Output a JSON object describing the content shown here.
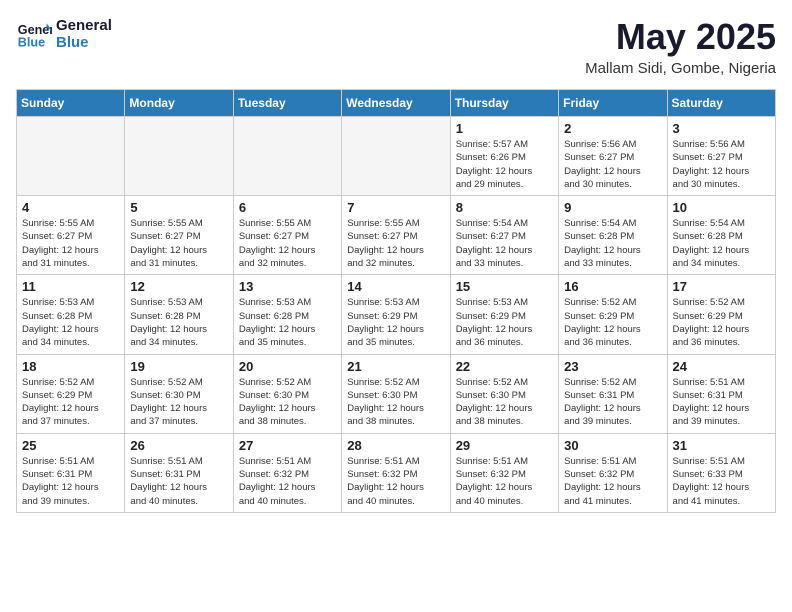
{
  "header": {
    "logo_line1": "General",
    "logo_line2": "Blue",
    "month_year": "May 2025",
    "location": "Mallam Sidi, Gombe, Nigeria"
  },
  "days_of_week": [
    "Sunday",
    "Monday",
    "Tuesday",
    "Wednesday",
    "Thursday",
    "Friday",
    "Saturday"
  ],
  "weeks": [
    [
      {
        "day": "",
        "info": ""
      },
      {
        "day": "",
        "info": ""
      },
      {
        "day": "",
        "info": ""
      },
      {
        "day": "",
        "info": ""
      },
      {
        "day": "1",
        "info": "Sunrise: 5:57 AM\nSunset: 6:26 PM\nDaylight: 12 hours\nand 29 minutes."
      },
      {
        "day": "2",
        "info": "Sunrise: 5:56 AM\nSunset: 6:27 PM\nDaylight: 12 hours\nand 30 minutes."
      },
      {
        "day": "3",
        "info": "Sunrise: 5:56 AM\nSunset: 6:27 PM\nDaylight: 12 hours\nand 30 minutes."
      }
    ],
    [
      {
        "day": "4",
        "info": "Sunrise: 5:55 AM\nSunset: 6:27 PM\nDaylight: 12 hours\nand 31 minutes."
      },
      {
        "day": "5",
        "info": "Sunrise: 5:55 AM\nSunset: 6:27 PM\nDaylight: 12 hours\nand 31 minutes."
      },
      {
        "day": "6",
        "info": "Sunrise: 5:55 AM\nSunset: 6:27 PM\nDaylight: 12 hours\nand 32 minutes."
      },
      {
        "day": "7",
        "info": "Sunrise: 5:55 AM\nSunset: 6:27 PM\nDaylight: 12 hours\nand 32 minutes."
      },
      {
        "day": "8",
        "info": "Sunrise: 5:54 AM\nSunset: 6:27 PM\nDaylight: 12 hours\nand 33 minutes."
      },
      {
        "day": "9",
        "info": "Sunrise: 5:54 AM\nSunset: 6:28 PM\nDaylight: 12 hours\nand 33 minutes."
      },
      {
        "day": "10",
        "info": "Sunrise: 5:54 AM\nSunset: 6:28 PM\nDaylight: 12 hours\nand 34 minutes."
      }
    ],
    [
      {
        "day": "11",
        "info": "Sunrise: 5:53 AM\nSunset: 6:28 PM\nDaylight: 12 hours\nand 34 minutes."
      },
      {
        "day": "12",
        "info": "Sunrise: 5:53 AM\nSunset: 6:28 PM\nDaylight: 12 hours\nand 34 minutes."
      },
      {
        "day": "13",
        "info": "Sunrise: 5:53 AM\nSunset: 6:28 PM\nDaylight: 12 hours\nand 35 minutes."
      },
      {
        "day": "14",
        "info": "Sunrise: 5:53 AM\nSunset: 6:29 PM\nDaylight: 12 hours\nand 35 minutes."
      },
      {
        "day": "15",
        "info": "Sunrise: 5:53 AM\nSunset: 6:29 PM\nDaylight: 12 hours\nand 36 minutes."
      },
      {
        "day": "16",
        "info": "Sunrise: 5:52 AM\nSunset: 6:29 PM\nDaylight: 12 hours\nand 36 minutes."
      },
      {
        "day": "17",
        "info": "Sunrise: 5:52 AM\nSunset: 6:29 PM\nDaylight: 12 hours\nand 36 minutes."
      }
    ],
    [
      {
        "day": "18",
        "info": "Sunrise: 5:52 AM\nSunset: 6:29 PM\nDaylight: 12 hours\nand 37 minutes."
      },
      {
        "day": "19",
        "info": "Sunrise: 5:52 AM\nSunset: 6:30 PM\nDaylight: 12 hours\nand 37 minutes."
      },
      {
        "day": "20",
        "info": "Sunrise: 5:52 AM\nSunset: 6:30 PM\nDaylight: 12 hours\nand 38 minutes."
      },
      {
        "day": "21",
        "info": "Sunrise: 5:52 AM\nSunset: 6:30 PM\nDaylight: 12 hours\nand 38 minutes."
      },
      {
        "day": "22",
        "info": "Sunrise: 5:52 AM\nSunset: 6:30 PM\nDaylight: 12 hours\nand 38 minutes."
      },
      {
        "day": "23",
        "info": "Sunrise: 5:52 AM\nSunset: 6:31 PM\nDaylight: 12 hours\nand 39 minutes."
      },
      {
        "day": "24",
        "info": "Sunrise: 5:51 AM\nSunset: 6:31 PM\nDaylight: 12 hours\nand 39 minutes."
      }
    ],
    [
      {
        "day": "25",
        "info": "Sunrise: 5:51 AM\nSunset: 6:31 PM\nDaylight: 12 hours\nand 39 minutes."
      },
      {
        "day": "26",
        "info": "Sunrise: 5:51 AM\nSunset: 6:31 PM\nDaylight: 12 hours\nand 40 minutes."
      },
      {
        "day": "27",
        "info": "Sunrise: 5:51 AM\nSunset: 6:32 PM\nDaylight: 12 hours\nand 40 minutes."
      },
      {
        "day": "28",
        "info": "Sunrise: 5:51 AM\nSunset: 6:32 PM\nDaylight: 12 hours\nand 40 minutes."
      },
      {
        "day": "29",
        "info": "Sunrise: 5:51 AM\nSunset: 6:32 PM\nDaylight: 12 hours\nand 40 minutes."
      },
      {
        "day": "30",
        "info": "Sunrise: 5:51 AM\nSunset: 6:32 PM\nDaylight: 12 hours\nand 41 minutes."
      },
      {
        "day": "31",
        "info": "Sunrise: 5:51 AM\nSunset: 6:33 PM\nDaylight: 12 hours\nand 41 minutes."
      }
    ]
  ]
}
